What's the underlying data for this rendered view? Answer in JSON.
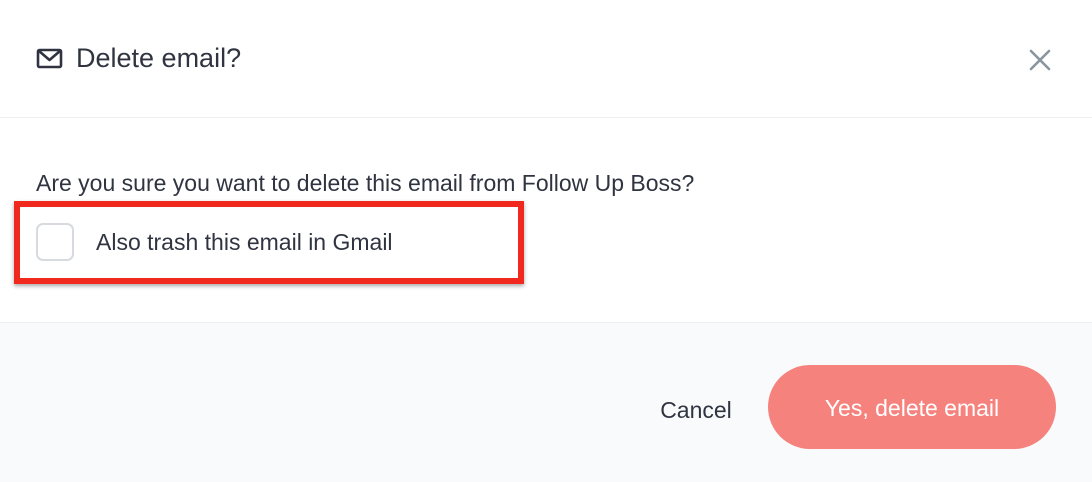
{
  "dialog": {
    "title": "Delete email?",
    "icon": "envelope-icon",
    "close_icon": "close-icon",
    "message": "Are you sure you want to delete this email from Follow Up Boss?",
    "checkbox": {
      "label": "Also trash this email in Gmail",
      "checked": false
    },
    "cancel_label": "Cancel",
    "confirm_label": "Yes, delete email"
  },
  "colors": {
    "highlight_border": "#f0281e",
    "confirm_button": "#f6827e",
    "footer_background": "#f8fafb",
    "text": "#2f3440"
  }
}
